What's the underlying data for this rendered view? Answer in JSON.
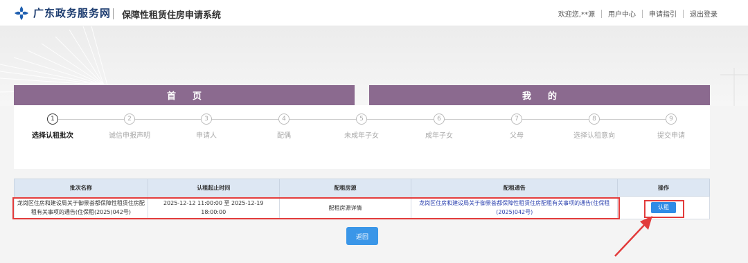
{
  "header": {
    "site_name": "广东政务服务网",
    "system_name": "保障性租赁住房申请系统",
    "nav": {
      "welcome": "欢迎您,**源",
      "user_center": "用户中心",
      "guide": "申请指引",
      "logout": "退出登录"
    }
  },
  "tabs": {
    "home": "首页",
    "mine": "我的"
  },
  "steps": [
    {
      "num": "1",
      "label": "选择认租批次",
      "active": true
    },
    {
      "num": "2",
      "label": "诚信申报声明",
      "active": false
    },
    {
      "num": "3",
      "label": "申请人",
      "active": false
    },
    {
      "num": "4",
      "label": "配偶",
      "active": false
    },
    {
      "num": "5",
      "label": "未成年子女",
      "active": false
    },
    {
      "num": "6",
      "label": "成年子女",
      "active": false
    },
    {
      "num": "7",
      "label": "父母",
      "active": false
    },
    {
      "num": "8",
      "label": "选择认租意向",
      "active": false
    },
    {
      "num": "9",
      "label": "提交申请",
      "active": false
    }
  ],
  "table": {
    "headers": [
      "批次名称",
      "认租起止时间",
      "配租房源",
      "配租通告",
      "操作"
    ],
    "rows": [
      {
        "batch_name": "龙岗区住房和建设局关于御景荟都保障性租赁住房配租有关事项的通告(住保租(2025)042号)",
        "time_range": "2025-12-12 11:00:00 至 2025-12-19 18:00:00",
        "housing": "配租房源详情",
        "notice": "龙岗区住房和建设局关于御景荟都保障性租赁住房配租有关事项的通告(住保租(2025)042号)",
        "action": "认租"
      }
    ]
  },
  "back_button": "返回",
  "colors": {
    "tab_purple": "#8b6a8f",
    "primary_blue": "#2e8be6",
    "highlight_red": "#e23b3b",
    "table_header_bg": "#dde7f3",
    "link_blue": "#2a3fae"
  }
}
